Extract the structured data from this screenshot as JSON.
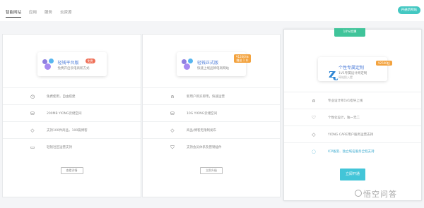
{
  "colors": {
    "accent": "#43c8c2",
    "brand_blue": "#4b7bd8",
    "free_badge": "#ef6f57",
    "price_badge": "#f3a33f",
    "ribbon_green": "#40c49a",
    "open_button": "#43c5d8"
  },
  "topbar": {
    "tabs": [
      {
        "label": "智能网站",
        "active": true
      },
      {
        "label": "应用",
        "active": false
      },
      {
        "label": "服务",
        "active": false
      },
      {
        "label": "云资源",
        "active": false
      }
    ],
    "action_label": "开通新网站"
  },
  "cards": [
    {
      "title": "轻钱平台版",
      "subtitle": "免费开启云电商新方式",
      "badge": "免费",
      "features": [
        {
          "icon": "clock-icon",
          "text": "免费使用，自由搭建"
        },
        {
          "icon": "database-icon",
          "text": "200MB YIONG云储空间"
        },
        {
          "icon": "tag-icon",
          "text": "支持100件商品，100篇博客"
        },
        {
          "icon": "monitor-icon",
          "text": "轻钱社区运营支持"
        }
      ],
      "button_label": "查看详情"
    },
    {
      "title": "轻钱正式版",
      "subtitle": "快速上线品牌电商网站",
      "badge_line1": "¥1200/年",
      "badge_line2": "赠送 1 年",
      "features": [
        {
          "icon": "user-icon",
          "text": "新用户即买即用，快速运营"
        },
        {
          "icon": "database-icon",
          "text": "10G YIONG云储空间"
        },
        {
          "icon": "tag-icon",
          "text": "商品/博客无限制发布"
        },
        {
          "icon": "shield-icon",
          "text": "支持会员体系及营销插件"
        }
      ],
      "button_label": "立即升级"
    },
    {
      "ribbon": "10%优惠",
      "title": "个性专属定制",
      "subtitle": "1V1专属设计师定制",
      "subtitle2": "网站投入提",
      "badge": "¥2500起",
      "features": [
        {
          "icon": "user-icon",
          "text": "专业设计师1V1指导上线"
        },
        {
          "icon": "heart-icon",
          "text": "个性化设计，独一无二"
        },
        {
          "icon": "tag-icon",
          "text": "YIONG CARE用户服务运营支持"
        },
        {
          "icon": "chat-icon",
          "text": "ICP备案、独立域名服务全程支持",
          "link": true
        }
      ],
      "button_label": "立即开通"
    }
  ],
  "watermark": "悟空问答"
}
